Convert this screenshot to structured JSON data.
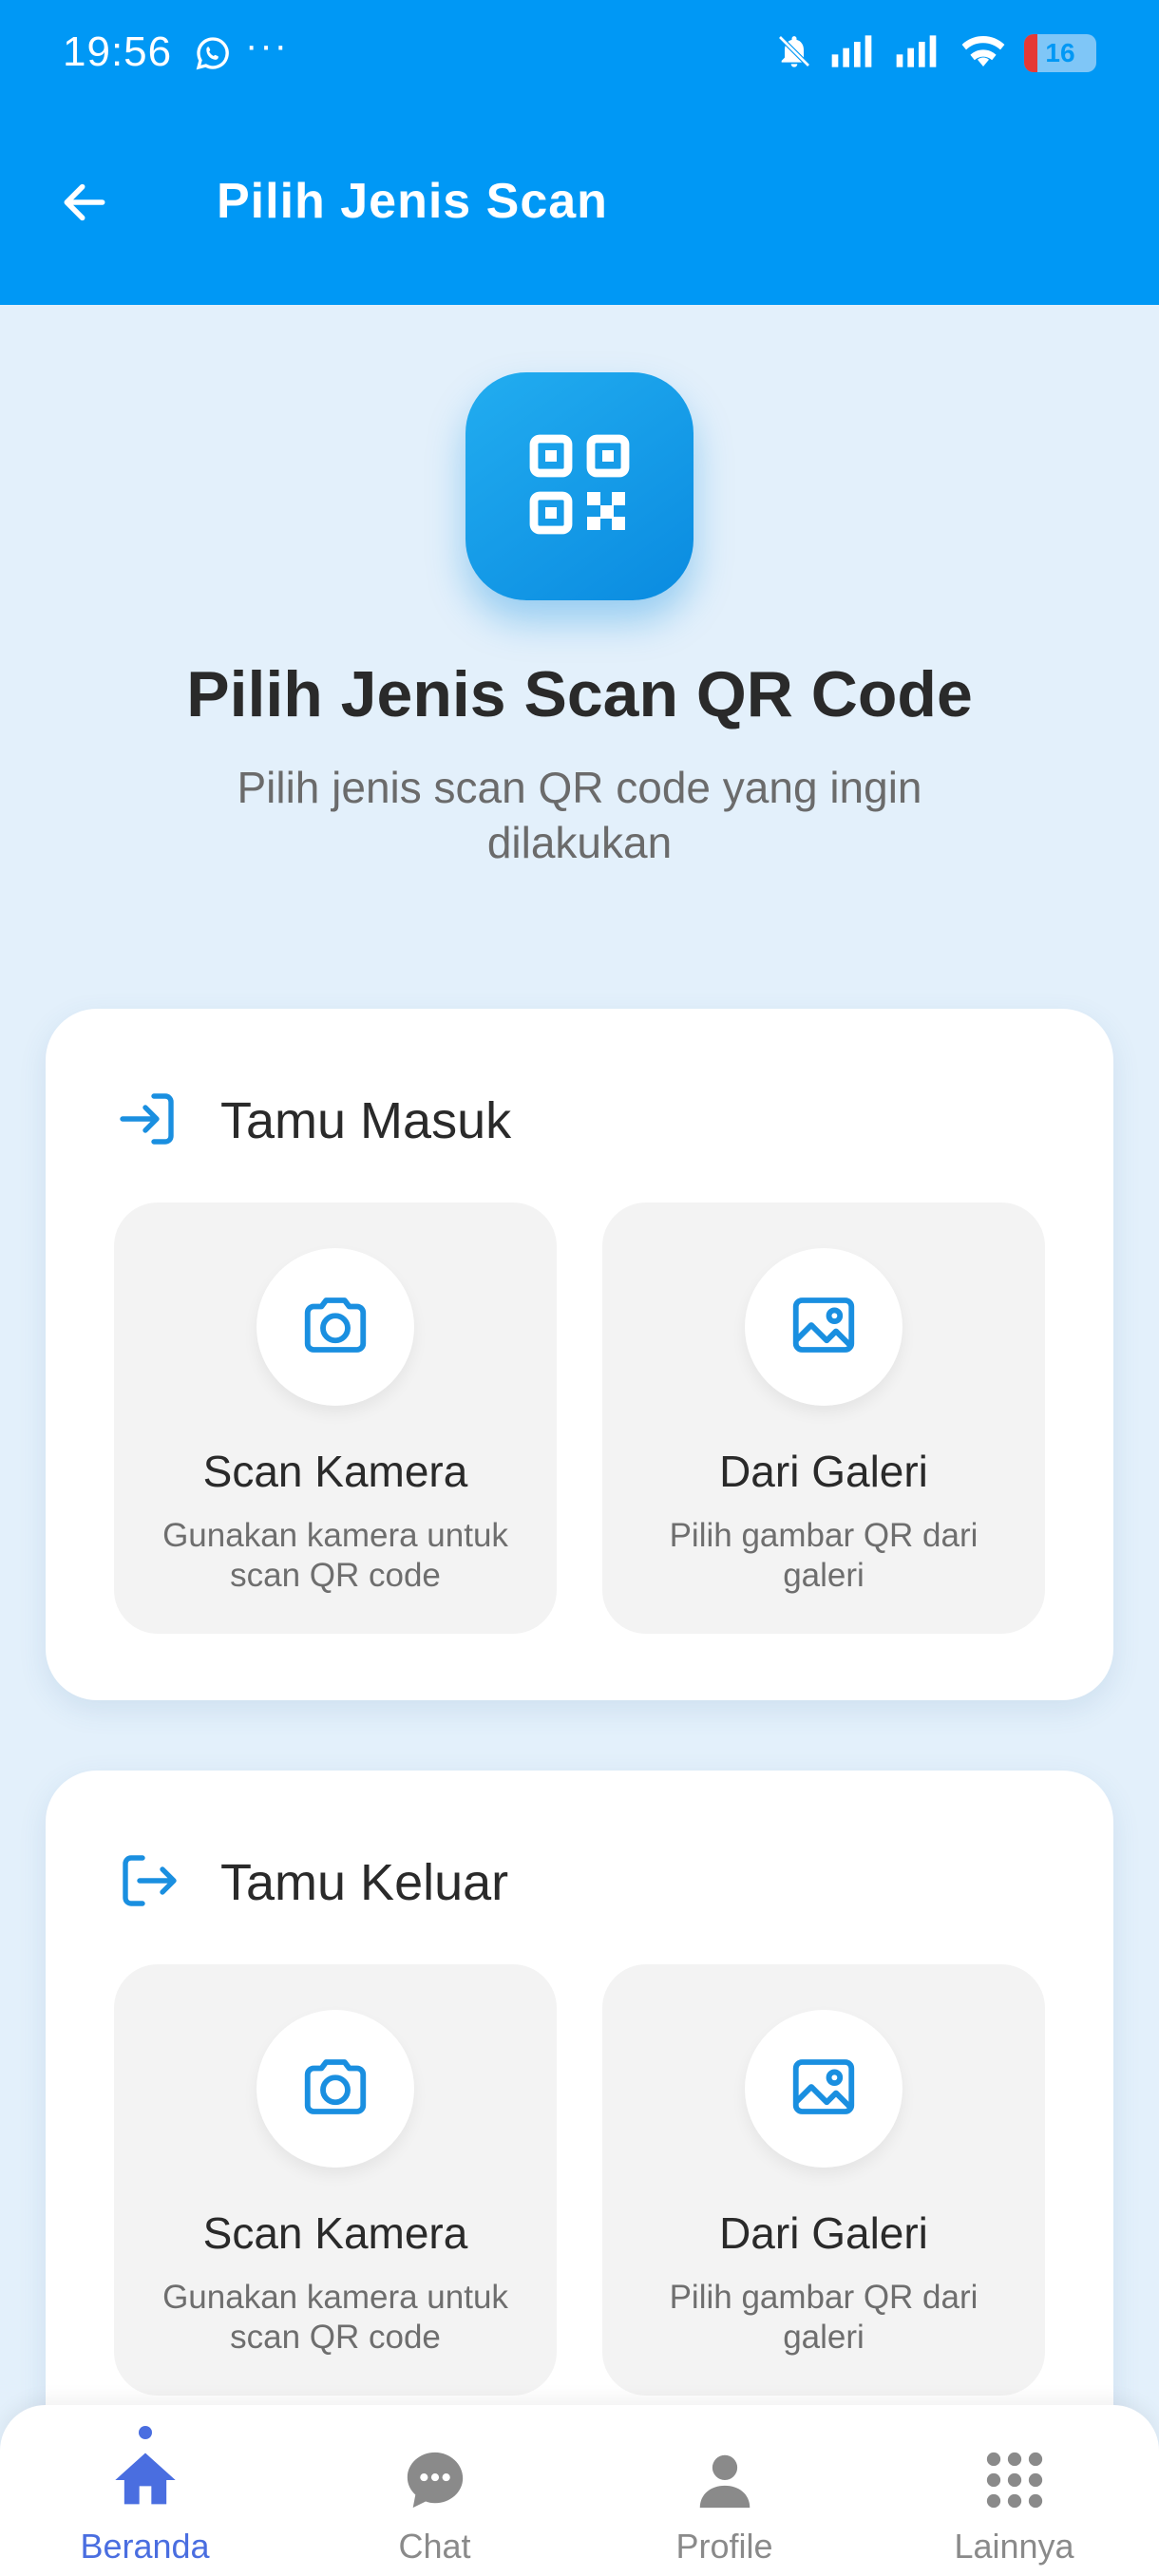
{
  "status_bar": {
    "time": "19:56",
    "more": "···",
    "battery_level": "16"
  },
  "appbar": {
    "title": "Pilih Jenis Scan"
  },
  "hero": {
    "title": "Pilih Jenis Scan QR Code",
    "subtitle": "Pilih jenis scan QR code yang ingin dilakukan"
  },
  "sections": [
    {
      "title": "Tamu Masuk",
      "icon": "login-icon",
      "options": [
        {
          "title": "Scan Kamera",
          "desc": "Gunakan kamera untuk scan QR code",
          "icon": "camera-icon"
        },
        {
          "title": "Dari Galeri",
          "desc": "Pilih gambar QR dari galeri",
          "icon": "image-icon"
        }
      ]
    },
    {
      "title": "Tamu Keluar",
      "icon": "logout-icon",
      "options": [
        {
          "title": "Scan Kamera",
          "desc": "Gunakan kamera untuk scan QR code",
          "icon": "camera-icon"
        },
        {
          "title": "Dari Galeri",
          "desc": "Pilih gambar QR dari galeri",
          "icon": "image-icon"
        }
      ]
    }
  ],
  "bottom_nav": [
    {
      "label": "Beranda",
      "icon": "home-icon",
      "active": true
    },
    {
      "label": "Chat",
      "icon": "chat-icon",
      "active": false
    },
    {
      "label": "Profile",
      "icon": "person-icon",
      "active": false
    },
    {
      "label": "Lainnya",
      "icon": "grid-icon",
      "active": false
    }
  ],
  "colors": {
    "primary": "#0098f5",
    "accent_icon": "#1a8fe0",
    "nav_active": "#4a6ee0",
    "background": "#e3f0fb"
  }
}
